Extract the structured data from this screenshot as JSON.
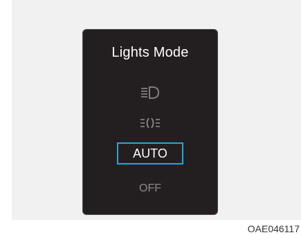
{
  "panel": {
    "title": "Lights Mode",
    "options": [
      {
        "icon": "low-beam-headlight-icon"
      },
      {
        "icon": "position-light-icon"
      },
      {
        "label": "AUTO",
        "selected": true
      },
      {
        "label": "OFF"
      }
    ]
  },
  "colors": {
    "background": "#f1f1f1",
    "panel": "#231f20",
    "selection_border": "#2aa6d4",
    "inactive_text": "#8a8a8a"
  },
  "figure_code": "OAE046117"
}
